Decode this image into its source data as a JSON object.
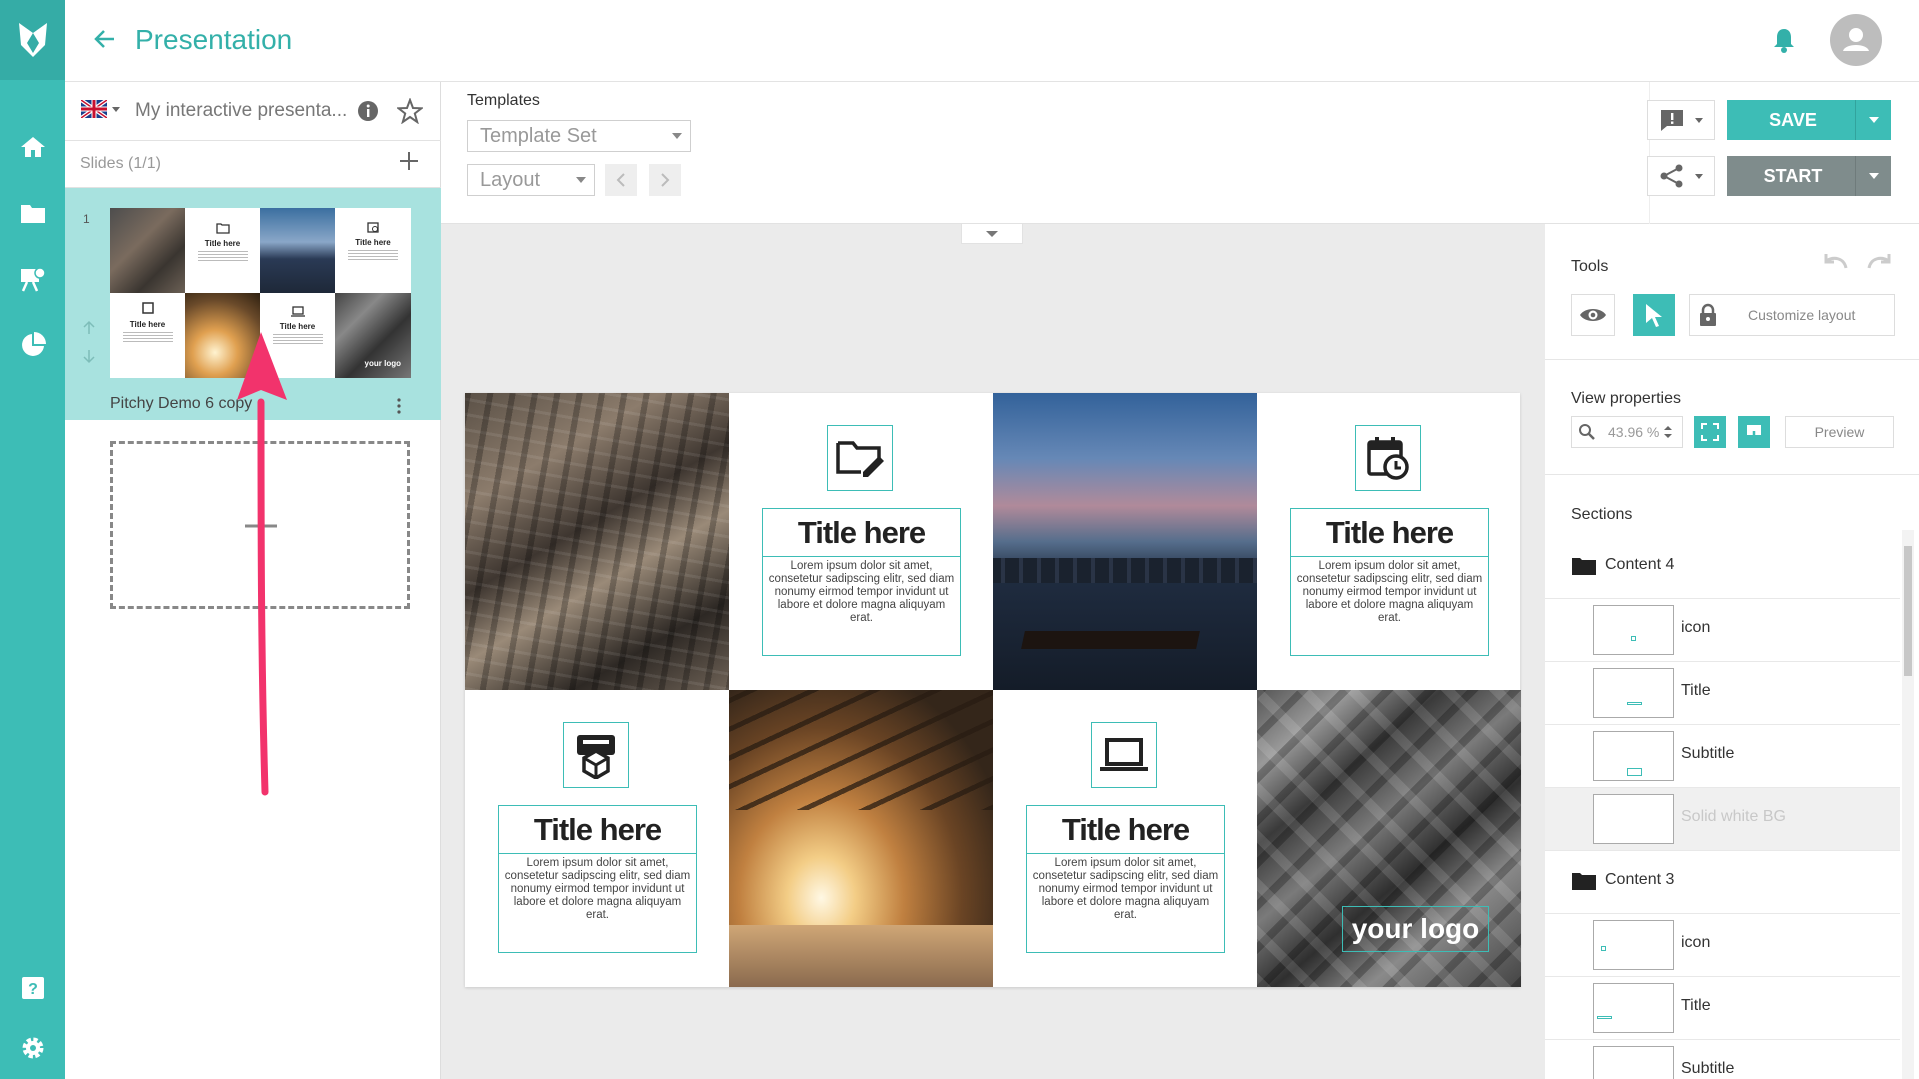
{
  "app": {
    "title": "Presentation",
    "accent": "#3dbdb6"
  },
  "left_panel": {
    "presentation_name": "My interactive presenta...",
    "slides_label": "Slides (1/1)",
    "slide_number": "1",
    "slide_name": "Pitchy Demo 6 copy",
    "thumb_titles": [
      "Title here",
      "Title here",
      "Title here",
      "Title here"
    ],
    "thumb_logo": "your logo"
  },
  "toolbar": {
    "templates_label": "Templates",
    "template_set": "Template Set",
    "layout": "Layout",
    "save": "SAVE",
    "start": "START"
  },
  "slide": {
    "tiles": [
      {
        "title": "Title here",
        "text": "Lorem ipsum dolor sit amet, consetetur sadipscing elitr, sed diam nonumy eirmod tempor invidunt ut labore et dolore magna aliquyam erat."
      },
      {
        "title": "Title here",
        "text": "Lorem ipsum dolor sit amet, consetetur sadipscing elitr, sed diam nonumy eirmod tempor invidunt ut labore et dolore magna aliquyam erat."
      },
      {
        "title": "Title here",
        "text": "Lorem ipsum dolor sit amet, consetetur sadipscing elitr, sed diam nonumy eirmod tempor invidunt ut labore et dolore magna aliquyam erat."
      },
      {
        "title": "Title here",
        "text": "Lorem ipsum dolor sit amet, consetetur sadipscing elitr, sed diam nonumy eirmod tempor invidunt ut labore et dolore magna aliquyam erat."
      }
    ],
    "logo": "your logo"
  },
  "right_panel": {
    "tools_label": "Tools",
    "customize_layout": "Customize layout",
    "view_properties_label": "View properties",
    "zoom": "43.96 %",
    "preview": "Preview",
    "sections_label": "Sections",
    "sections": [
      {
        "name": "Content 4",
        "items": [
          "icon",
          "Title",
          "Subtitle",
          "Solid white BG"
        ]
      },
      {
        "name": "Content 3",
        "items": [
          "icon",
          "Title",
          "Subtitle"
        ]
      }
    ]
  }
}
